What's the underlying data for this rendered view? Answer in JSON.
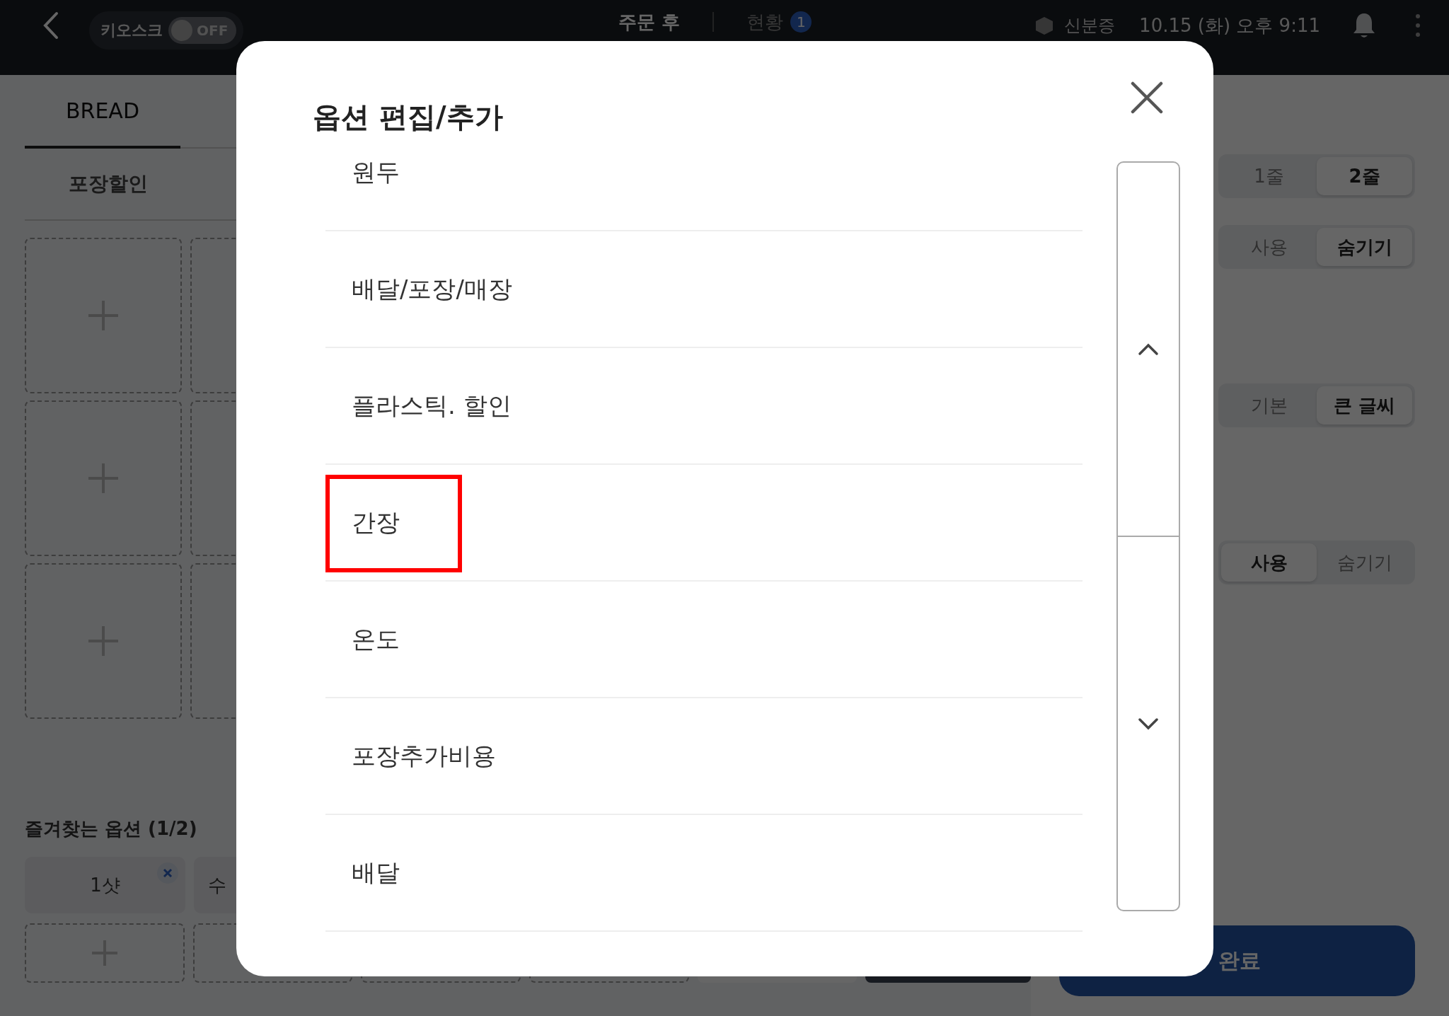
{
  "top_bar": {
    "kiosk_label": "키오스크",
    "kiosk_toggle": {
      "label": "OFF",
      "on": false
    },
    "tabs": [
      {
        "label": "주문 후",
        "selected": true
      },
      {
        "label": "현황",
        "badge": "1",
        "selected": false
      }
    ],
    "status": "신분증",
    "datetime": "10.15 (화) 오후 9:11"
  },
  "menu_panel": {
    "category_tabs": [
      {
        "label": "BREAD",
        "selected": true
      }
    ],
    "option_group": "포장할인",
    "tiles": [
      {
        "kind": "empty"
      },
      {
        "kind": "covered"
      },
      {
        "kind": "empty"
      },
      {
        "kind": "covered"
      },
      {
        "kind": "empty"
      },
      {
        "kind": "covered"
      }
    ],
    "favorites": {
      "title": "즐겨찾는 옵션 (1/2)",
      "chips": [
        {
          "label": "1샷",
          "removable": true
        },
        {
          "label": "수"
        }
      ],
      "slots": [
        {
          "kind": "empty"
        },
        {
          "kind": "covered"
        },
        {
          "kind": "covered"
        },
        {
          "kind": "covered"
        },
        {
          "kind": "blank"
        },
        {
          "kind": "dark"
        }
      ]
    }
  },
  "settings": [
    {
      "options": [
        {
          "label": "1줄",
          "selected": false
        },
        {
          "label": "2줄",
          "selected": true
        }
      ]
    },
    {
      "options": [
        {
          "label": "사용",
          "selected": false
        },
        {
          "label": "숨기기",
          "selected": true
        }
      ]
    },
    {
      "options": [
        {
          "label": "기본",
          "selected": false
        },
        {
          "label": "큰 글씨",
          "selected": true
        }
      ]
    },
    {
      "options": [
        {
          "label": "사용",
          "selected": true
        },
        {
          "label": "숨기기",
          "selected": false
        }
      ]
    }
  ],
  "done_button": "완료",
  "modal": {
    "title": "옵션 편집/추가",
    "items": [
      {
        "label": "원두",
        "highlighted": false
      },
      {
        "label": "배달/포장/매장",
        "highlighted": false
      },
      {
        "label": "플라스틱. 할인",
        "highlighted": false
      },
      {
        "label": "간장",
        "highlighted": true
      },
      {
        "label": "온도",
        "highlighted": false
      },
      {
        "label": "포장추가비용",
        "highlighted": false
      },
      {
        "label": "배달",
        "highlighted": false
      }
    ]
  }
}
